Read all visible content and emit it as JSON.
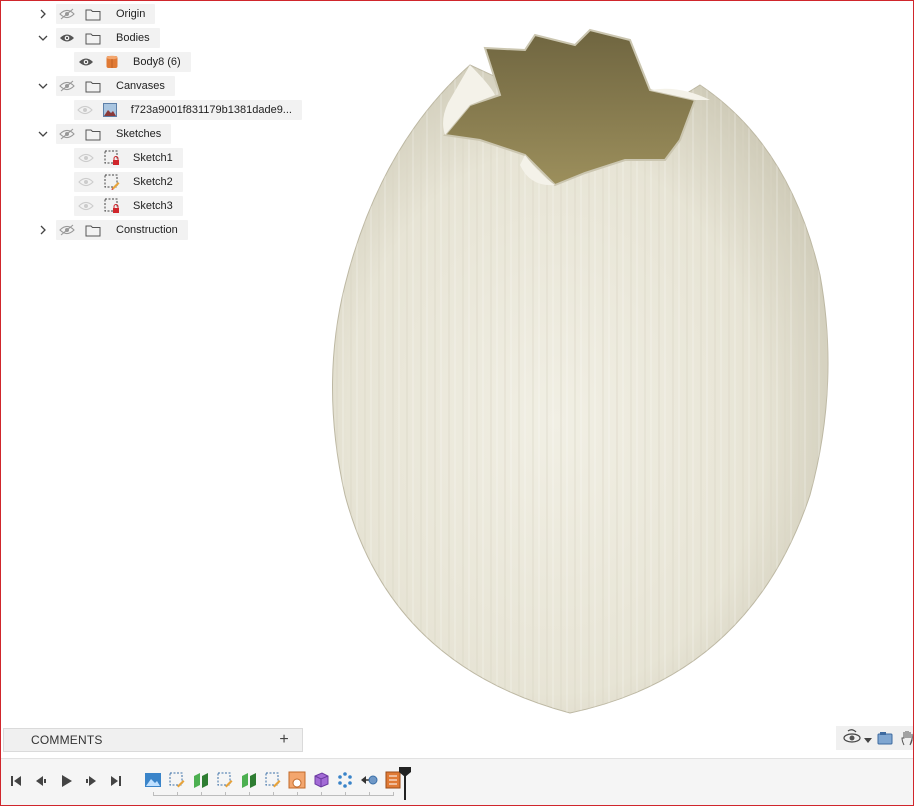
{
  "browser": {
    "items": [
      {
        "label": "Origin",
        "visible": false,
        "expanded": false,
        "level": 0,
        "icon": "folder-icon"
      },
      {
        "label": "Bodies",
        "visible": true,
        "expanded": true,
        "level": 0,
        "icon": "folder-icon"
      },
      {
        "label": "Body8 (6)",
        "visible": true,
        "level": 1,
        "icon": "body-icon"
      },
      {
        "label": "Canvases",
        "visible": false,
        "expanded": true,
        "level": 0,
        "icon": "folder-icon"
      },
      {
        "label": "f723a9001f831179b1381dade9...",
        "visible": false,
        "level": 1,
        "icon": "canvas-image-icon"
      },
      {
        "label": "Sketches",
        "visible": false,
        "expanded": true,
        "level": 0,
        "icon": "folder-icon"
      },
      {
        "label": "Sketch1",
        "visible": false,
        "level": 1,
        "icon": "sketch-locked-icon"
      },
      {
        "label": "Sketch2",
        "visible": false,
        "level": 1,
        "icon": "sketch-edit-icon"
      },
      {
        "label": "Sketch3",
        "visible": false,
        "level": 1,
        "icon": "sketch-locked-icon"
      },
      {
        "label": "Construction",
        "visible": false,
        "expanded": false,
        "level": 0,
        "icon": "folder-icon"
      }
    ]
  },
  "comments": {
    "title": "COMMENTS",
    "add_label": "+"
  },
  "model": {
    "body_color": "#e9e6d8",
    "interior_color": "#8a7d4e"
  },
  "timeline": {
    "controls": [
      "skip-to-start-icon",
      "step-back-icon",
      "play-icon",
      "step-forward-icon",
      "skip-to-end-icon"
    ],
    "features": [
      "canvas-feature-icon",
      "sketch-feature-icon",
      "extrude-feature-icon",
      "sketch-feature-icon",
      "extrude-feature-icon",
      "sketch-feature-icon",
      "form-feature-icon",
      "box-feature-icon",
      "pattern-feature-icon",
      "move-feature-icon",
      "marker-feature-icon"
    ]
  },
  "colors": {
    "accent": "#d0262c",
    "folder": "#555555",
    "body": "#e07a35"
  }
}
